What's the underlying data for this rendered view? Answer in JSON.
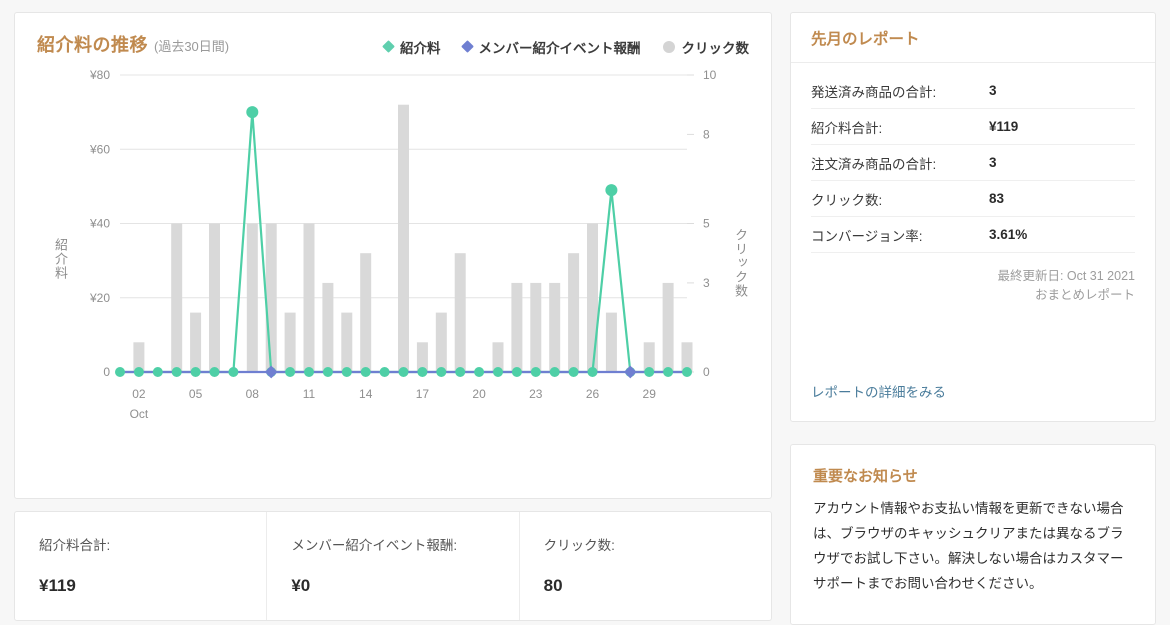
{
  "chart": {
    "title": "紹介料の推移",
    "subtitle": "(過去30日間)",
    "legend": [
      {
        "label": "紹介料",
        "marker": "diamond",
        "color": "#5fcfae"
      },
      {
        "label": "メンバー紹介イベント報酬",
        "marker": "diamond",
        "color": "#6f7fd1"
      },
      {
        "label": "クリック数",
        "marker": "circle",
        "color": "#d4d4d4"
      }
    ],
    "y_left_label": "紹介料",
    "y_right_label": "クリック数"
  },
  "chart_data": {
    "type": "bar",
    "title": "紹介料の推移 (過去30日間)",
    "xlabel": "Oct",
    "ylabel": "紹介料",
    "y2label": "クリック数",
    "ylim": [
      0,
      80
    ],
    "y2lim": [
      0,
      10
    ],
    "yticks": [
      "0",
      "¥20",
      "¥40",
      "¥60",
      "¥80"
    ],
    "ytick_values": [
      0,
      20,
      40,
      60,
      80
    ],
    "y2ticks": [
      "0",
      "3",
      "5",
      "8",
      "10"
    ],
    "y2tick_values": [
      0,
      3,
      5,
      8,
      10
    ],
    "grid": true,
    "legend_position": "top-right",
    "x": [
      "01",
      "02",
      "03",
      "04",
      "05",
      "06",
      "07",
      "08",
      "09",
      "10",
      "11",
      "12",
      "13",
      "14",
      "15",
      "16",
      "17",
      "18",
      "19",
      "20",
      "21",
      "22",
      "23",
      "24",
      "25",
      "26",
      "27",
      "28",
      "29",
      "30"
    ],
    "xtick_labels": [
      "02",
      "05",
      "08",
      "11",
      "14",
      "17",
      "20",
      "23",
      "26",
      "29"
    ],
    "xtick_indices": [
      1,
      4,
      7,
      10,
      13,
      16,
      19,
      22,
      25,
      28
    ],
    "xtick_sublabel": "Oct",
    "series": [
      {
        "name": "クリック数",
        "type": "bar",
        "axis": "right",
        "color": "#d9d9d9",
        "values_yen_scale": [
          0,
          8,
          0,
          40,
          16,
          40,
          0,
          40,
          40,
          16,
          40,
          24,
          16,
          32,
          0,
          72,
          8,
          16,
          32,
          0,
          8,
          24,
          24,
          24,
          32,
          40,
          16,
          0,
          8,
          24,
          8
        ],
        "values": [
          0,
          1,
          0,
          5,
          2,
          5,
          0,
          5,
          5,
          2,
          5,
          3,
          2,
          4,
          0,
          9,
          1,
          2,
          4,
          0,
          1,
          3,
          3,
          3,
          4,
          5,
          2,
          0,
          1,
          3,
          1
        ]
      },
      {
        "name": "紹介料",
        "type": "line",
        "axis": "left",
        "color": "#4ecfa6",
        "values": [
          0,
          0,
          0,
          0,
          0,
          0,
          0,
          70,
          0,
          0,
          0,
          0,
          0,
          0,
          0,
          0,
          0,
          0,
          0,
          0,
          0,
          0,
          0,
          0,
          0,
          0,
          49,
          0,
          0,
          0,
          0
        ]
      },
      {
        "name": "メンバー紹介イベント報酬",
        "type": "line",
        "axis": "left",
        "color": "#6f7fd1",
        "values": [
          0,
          0,
          0,
          0,
          0,
          0,
          0,
          0,
          0,
          0,
          0,
          0,
          0,
          0,
          0,
          0,
          0,
          0,
          0,
          0,
          0,
          0,
          0,
          0,
          0,
          0,
          0,
          0,
          0,
          0,
          0
        ],
        "marker_indices": [
          8,
          27
        ]
      }
    ]
  },
  "summary": [
    {
      "label": "紹介料合計:",
      "value": "¥119"
    },
    {
      "label": "メンバー紹介イベント報酬:",
      "value": "¥0"
    },
    {
      "label": "クリック数:",
      "value": "80"
    }
  ],
  "report": {
    "title": "先月のレポート",
    "rows": [
      {
        "key": "発送済み商品の合計:",
        "value": "3"
      },
      {
        "key": "紹介料合計:",
        "value": "¥119"
      },
      {
        "key": "注文済み商品の合計:",
        "value": "3"
      },
      {
        "key": "クリック数:",
        "value": "83"
      },
      {
        "key": "コンバージョン率:",
        "value": "3.61%"
      }
    ],
    "updated": "最終更新日: Oct 31 2021",
    "report_kind": "おまとめレポート",
    "link": "レポートの詳細をみる"
  },
  "notice": {
    "title": "重要なお知らせ",
    "text": "アカウント情報やお支払い情報を更新できない場合は、ブラウザのキャッシュクリアまたは異なるブラウザでお試し下さい。解決しない場合はカスタマーサポートまでお問い合わせください。"
  }
}
